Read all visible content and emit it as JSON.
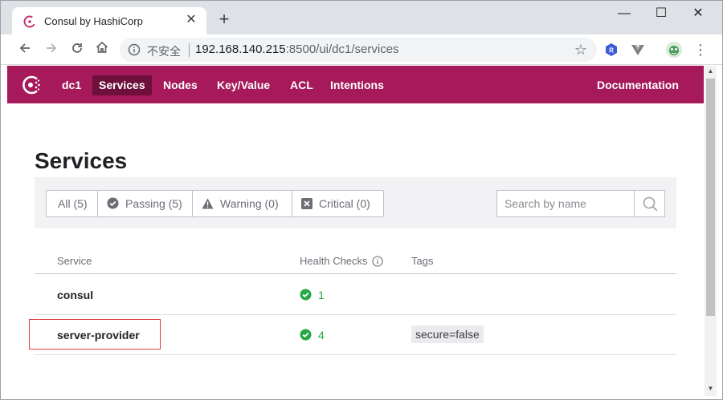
{
  "browser": {
    "tab_title": "Consul by HashiCorp",
    "tab_close": "✕",
    "new_tab": "+",
    "window_controls": {
      "minimize": "—",
      "maximize": "☐",
      "close": "✕"
    },
    "address": {
      "insecure_label": "不安全",
      "url_host": "192.168.140.215",
      "url_rest": ":8500/ui/dc1/services"
    }
  },
  "nav": {
    "datacenter": "dc1",
    "items": [
      {
        "label": "Services",
        "active": true
      },
      {
        "label": "Nodes"
      },
      {
        "label": "Key/Value"
      },
      {
        "label": "ACL"
      },
      {
        "label": "Intentions"
      }
    ],
    "documentation": "Documentation"
  },
  "page": {
    "title": "Services",
    "filters": [
      {
        "label": "All (5)",
        "icon": "none"
      },
      {
        "label": "Passing (5)",
        "icon": "check-circle-icon"
      },
      {
        "label": "Warning (0)",
        "icon": "warning-icon"
      },
      {
        "label": "Critical (0)",
        "icon": "critical-icon"
      }
    ],
    "search_placeholder": "Search by name"
  },
  "table": {
    "headers": {
      "service": "Service",
      "health": "Health Checks",
      "tags": "Tags"
    },
    "rows": [
      {
        "service": "consul",
        "health": "1",
        "tags": ""
      },
      {
        "service": "server-provider",
        "health": "4",
        "tags": "secure=false"
      }
    ]
  },
  "colors": {
    "brand": "#a6195a",
    "brand_active": "#6e0f3c",
    "passing": "#28a745",
    "highlight_box": "#e03a3e"
  }
}
